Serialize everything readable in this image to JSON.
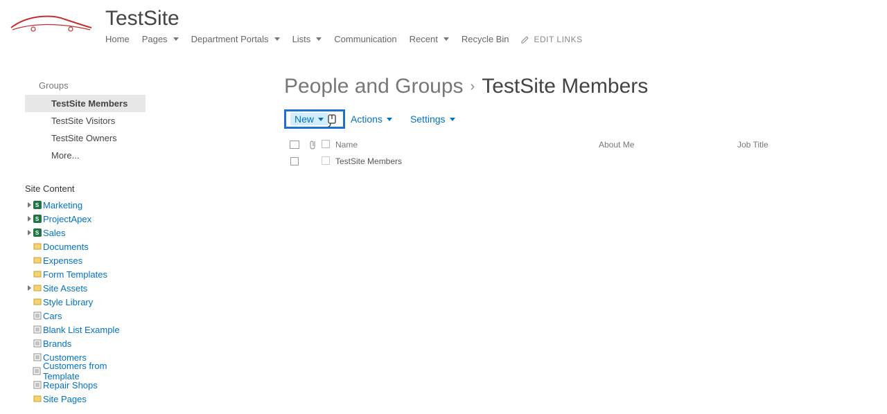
{
  "site": {
    "title": "TestSite"
  },
  "topnav": {
    "items": [
      {
        "label": "Home",
        "dropdown": false
      },
      {
        "label": "Pages",
        "dropdown": true
      },
      {
        "label": "Department Portals",
        "dropdown": true
      },
      {
        "label": "Lists",
        "dropdown": true
      },
      {
        "label": "Communication",
        "dropdown": false
      },
      {
        "label": "Recent",
        "dropdown": true
      },
      {
        "label": "Recycle Bin",
        "dropdown": false
      }
    ],
    "edit_links": "EDIT LINKS"
  },
  "leftnav": {
    "groups_header": "Groups",
    "groups": [
      {
        "label": "TestSite Members",
        "selected": true
      },
      {
        "label": "TestSite Visitors",
        "selected": false
      },
      {
        "label": "TestSite Owners",
        "selected": false
      },
      {
        "label": "More...",
        "selected": false
      }
    ],
    "site_content_header": "Site Content",
    "tree": [
      {
        "label": "Marketing",
        "icon": "subsite",
        "has_children": true
      },
      {
        "label": "ProjectApex",
        "icon": "subsite",
        "has_children": true
      },
      {
        "label": "Sales",
        "icon": "subsite",
        "has_children": true
      },
      {
        "label": "Documents",
        "icon": "library",
        "has_children": false
      },
      {
        "label": "Expenses",
        "icon": "library",
        "has_children": false
      },
      {
        "label": "Form Templates",
        "icon": "library",
        "has_children": false
      },
      {
        "label": "Site Assets",
        "icon": "library",
        "has_children": true
      },
      {
        "label": "Style Library",
        "icon": "library",
        "has_children": false
      },
      {
        "label": "Cars",
        "icon": "list",
        "has_children": false
      },
      {
        "label": "Blank List Example",
        "icon": "list",
        "has_children": false
      },
      {
        "label": "Brands",
        "icon": "list",
        "has_children": false
      },
      {
        "label": "Customers",
        "icon": "list",
        "has_children": false
      },
      {
        "label": "Customers from Template",
        "icon": "list",
        "has_children": false
      },
      {
        "label": "Repair Shops",
        "icon": "list",
        "has_children": false
      },
      {
        "label": "Site Pages",
        "icon": "library",
        "has_children": false
      }
    ]
  },
  "page": {
    "breadcrumb_root": "People and Groups",
    "breadcrumb_sep": "›",
    "title": "TestSite Members",
    "toolbar": {
      "new": "New",
      "actions": "Actions",
      "settings": "Settings"
    },
    "columns": {
      "name": "Name",
      "about": "About Me",
      "job": "Job Title"
    },
    "rows": [
      {
        "name": "TestSite Members"
      }
    ]
  }
}
